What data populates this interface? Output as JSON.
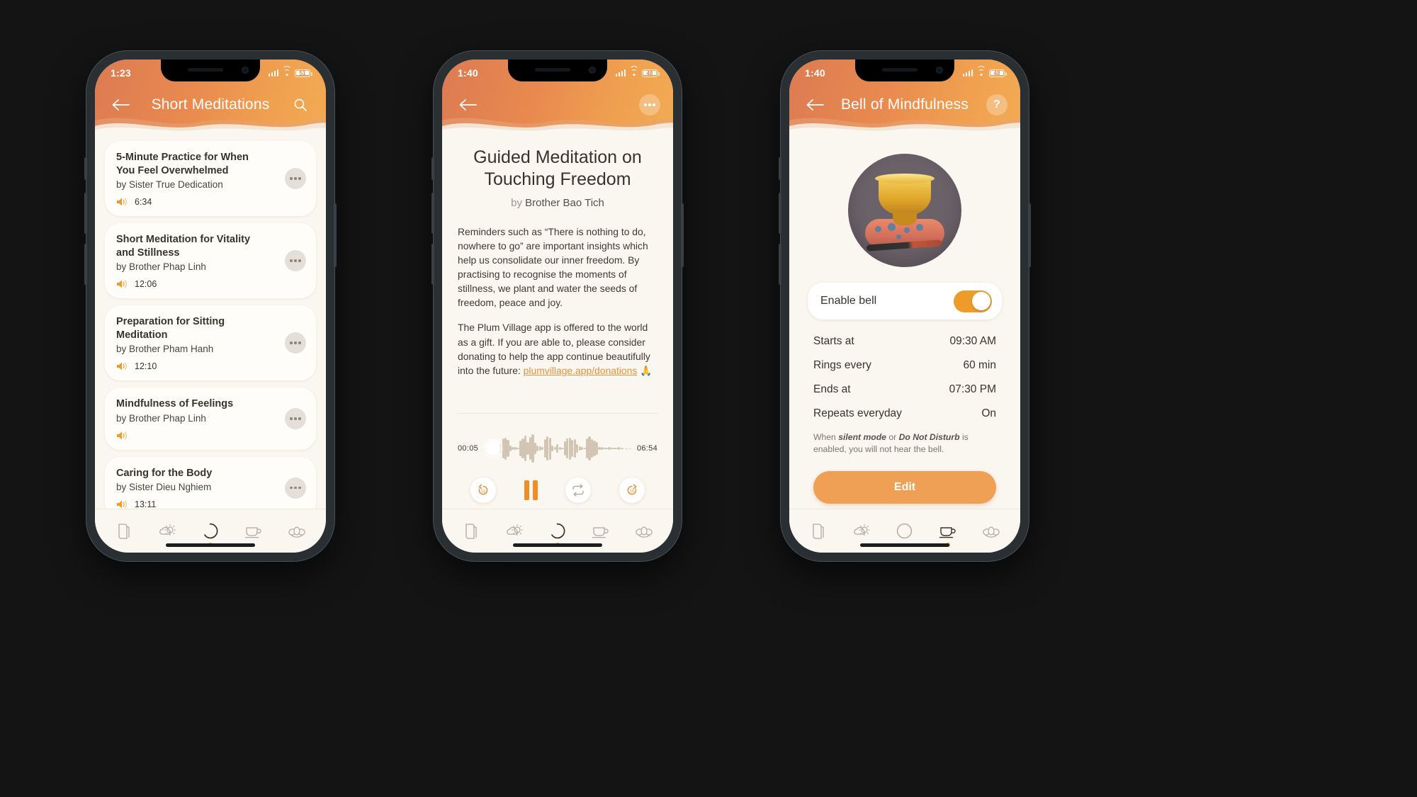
{
  "theme": {
    "accent": "#ef9b29",
    "header_gradient_start": "#dc7b52",
    "header_gradient_end": "#f2ab53",
    "page_bg": "#faf6f0",
    "card_bg": "#fffdfa",
    "text_dark": "#3a322d"
  },
  "phone1": {
    "status": {
      "time": "1:23",
      "battery": "51"
    },
    "header": {
      "title": "Short Meditations",
      "back_icon": "arrow-left-icon",
      "search_icon": "search-icon"
    },
    "list": [
      {
        "title": "5-Minute Practice for When You Feel Overwhelmed",
        "author": "by Sister True Dedication",
        "duration": "6:34",
        "audio_icon": "speaker-icon",
        "menu_icon": "kebab-menu-icon"
      },
      {
        "title": "Short Meditation for Vitality and Stillness",
        "author": "by Brother Phap Linh",
        "duration": "12:06",
        "audio_icon": "speaker-icon",
        "menu_icon": "kebab-menu-icon"
      },
      {
        "title": "Preparation for Sitting Meditation",
        "author": "by Brother Pham Hanh",
        "duration": "12:10",
        "audio_icon": "speaker-icon",
        "menu_icon": "kebab-menu-icon"
      },
      {
        "title": "Mindfulness of Feelings",
        "author": "by Brother Phap Linh",
        "duration": "",
        "audio_icon": "speaker-icon",
        "menu_icon": "kebab-menu-icon"
      },
      {
        "title": "Caring for the Body",
        "author": "by Sister Dieu Nghiem",
        "duration": "13:11",
        "audio_icon": "speaker-icon",
        "menu_icon": "kebab-menu-icon"
      }
    ],
    "tabs": [
      {
        "name": "book-icon",
        "active": false
      },
      {
        "name": "sun-cloud-icon",
        "active": false
      },
      {
        "name": "circle-enso-icon",
        "active": true
      },
      {
        "name": "cup-icon",
        "active": false
      },
      {
        "name": "lotus-icon",
        "active": false
      }
    ]
  },
  "phone2": {
    "status": {
      "time": "1:40",
      "battery": "48"
    },
    "header": {
      "back_icon": "arrow-left-icon",
      "more_icon": "more-options-icon"
    },
    "detail": {
      "title": "Guided Meditation on Touching Freedom",
      "by_label": "by",
      "author": "Brother Bao Tich",
      "paragraph1": "Reminders such as “There is nothing to do, nowhere to go” are important insights which help us consolidate our inner freedom. By practising to recognise the moments of stillness, we plant and water the seeds of freedom, peace and joy.",
      "paragraph2_before_link": "The Plum Village app is offered to the world as a gift. If you are able to, please consider donating to help the app continue beautifully into the future: ",
      "link_text": "plumvillage.app/donations",
      "paragraph2_after_link": " 🙏"
    },
    "player": {
      "elapsed": "00:05",
      "remaining": "06:54",
      "progress_percent": 2,
      "rewind_icon": "rewind-15-icon",
      "rewind_label": "15",
      "play_state_icon": "pause-icon",
      "repeat_icon": "repeat-icon",
      "forward_icon": "forward-15-icon",
      "waveform": [
        22,
        46,
        50,
        38,
        12,
        8,
        6,
        4,
        34,
        46,
        58,
        30,
        52,
        66,
        26,
        14,
        10,
        8,
        42,
        54,
        50,
        12,
        8,
        18,
        6,
        4,
        32,
        44,
        50,
        38,
        42,
        20,
        10,
        6,
        4,
        46,
        54,
        42,
        36,
        30,
        8,
        6,
        4,
        3,
        6,
        4,
        3,
        2,
        6,
        4
      ]
    },
    "tabs": [
      {
        "name": "book-icon",
        "active": false
      },
      {
        "name": "sun-cloud-icon",
        "active": false
      },
      {
        "name": "circle-enso-icon",
        "active": true
      },
      {
        "name": "cup-icon",
        "active": false
      },
      {
        "name": "lotus-icon",
        "active": false
      }
    ]
  },
  "phone3": {
    "status": {
      "time": "1:40",
      "battery": "48"
    },
    "header": {
      "title": "Bell of Mindfulness",
      "back_icon": "arrow-left-icon",
      "help_icon": "help-question-icon",
      "help_label": "?"
    },
    "illustration": "singing-bowl-image",
    "toggle": {
      "label": "Enable bell",
      "state": "on"
    },
    "settings": [
      {
        "key": "Starts at",
        "value": "09:30 AM"
      },
      {
        "key": "Rings every",
        "value": "60 min"
      },
      {
        "key": "Ends at",
        "value": "07:30 PM"
      },
      {
        "key": "Repeats everyday",
        "value": "On"
      }
    ],
    "note": {
      "part1": "When ",
      "bold1": "silent mode",
      "part2": " or ",
      "bold2": "Do Not Disturb",
      "part3": " is enabled, you will not hear the bell."
    },
    "edit_button": "Edit",
    "tabs": [
      {
        "name": "book-icon",
        "active": false
      },
      {
        "name": "sun-cloud-icon",
        "active": false
      },
      {
        "name": "circle-enso-icon",
        "active": false
      },
      {
        "name": "cup-icon",
        "active": true
      },
      {
        "name": "lotus-icon",
        "active": false
      }
    ]
  }
}
